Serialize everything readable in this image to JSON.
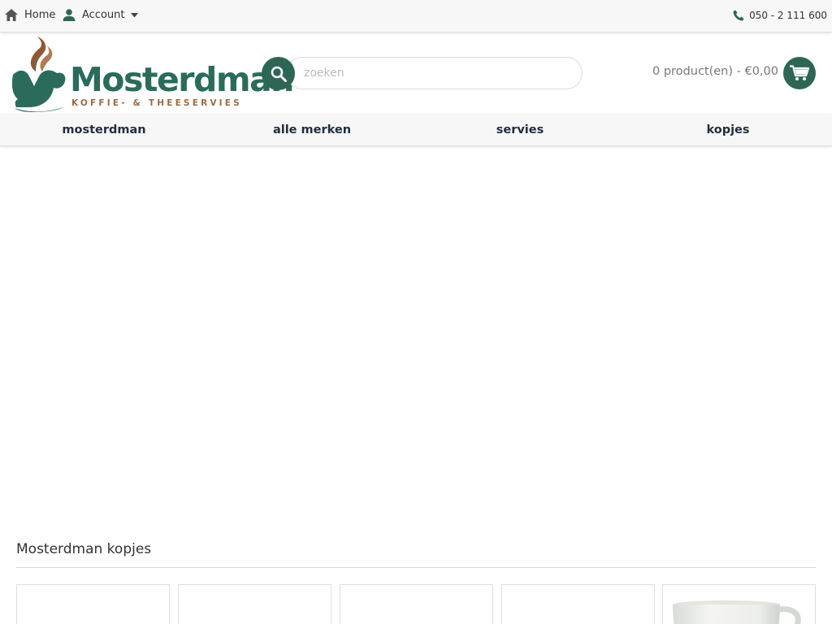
{
  "topbar": {
    "home_label": "Home",
    "account_label": "Account",
    "phone": "050 - 2 111 600",
    "icons": {
      "home": "home-icon",
      "account": "user-icon",
      "caret": "caret-down-icon",
      "phone": "phone-icon"
    }
  },
  "header": {
    "logo": {
      "wordmark": "Mosterdman",
      "tagline": "KOFFIE- & THEESERVIES"
    },
    "search": {
      "placeholder": "zoeken",
      "value": "",
      "icon": "search-icon"
    },
    "cart": {
      "summary": "0 product(en) - €0,00",
      "icon": "cart-icon"
    }
  },
  "nav": {
    "items": [
      {
        "label": "mosterdman"
      },
      {
        "label": "alle merken"
      },
      {
        "label": "servies"
      },
      {
        "label": "kopjes"
      }
    ]
  },
  "section": {
    "title": "Mosterdman kopjes",
    "products": [
      {
        "image": ""
      },
      {
        "image": ""
      },
      {
        "image": ""
      },
      {
        "image": ""
      },
      {
        "image": "white-cup-image"
      }
    ]
  },
  "colors": {
    "brand_green": "#2e6656",
    "logo_green": "#2b6b5b",
    "logo_brown": "#9a6b45",
    "nav_text": "#1f2f3f",
    "bar_bg": "#f7f7f7"
  }
}
